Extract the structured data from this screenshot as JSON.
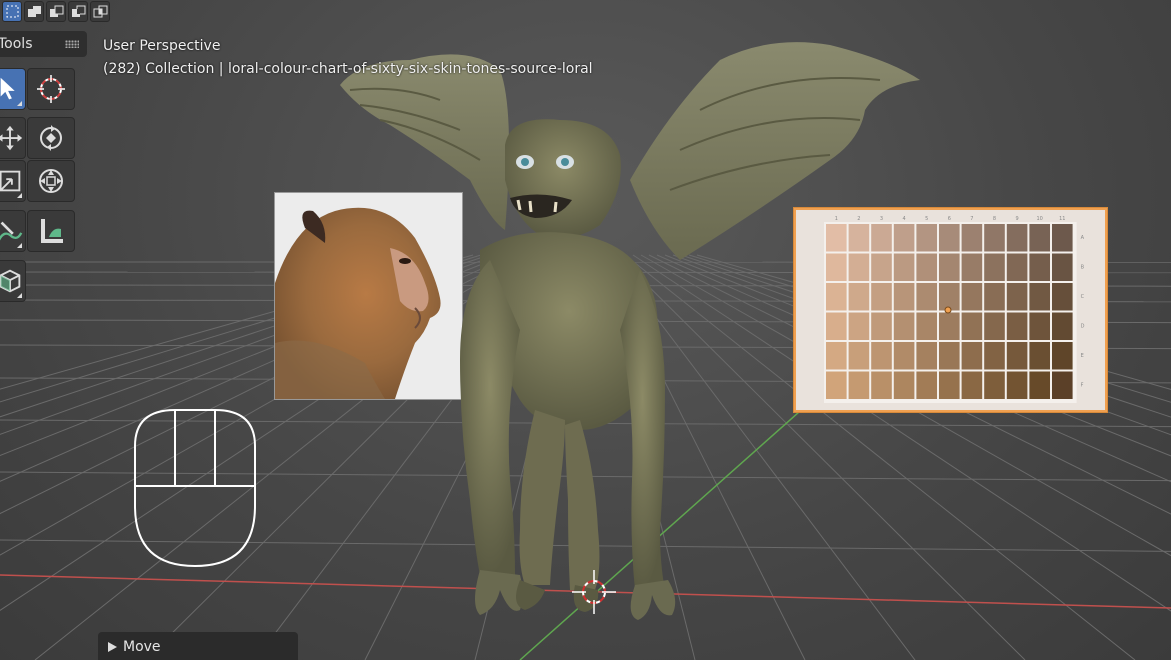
{
  "header": {
    "mode_buttons": [
      {
        "name": "select-box-mode-icon",
        "active": true
      },
      {
        "name": "mode-extend-icon",
        "active": false
      },
      {
        "name": "mode-subtract-icon",
        "active": false
      },
      {
        "name": "mode-difference-icon",
        "active": false
      },
      {
        "name": "mode-intersect-icon",
        "active": false
      }
    ]
  },
  "toolbar": {
    "title": "Tools",
    "tools": [
      {
        "name": "select-tool-icon",
        "active": true
      },
      {
        "name": "cursor-tool-icon",
        "active": false
      },
      {
        "name": "move-tool-icon",
        "active": false
      },
      {
        "name": "rotate-tool-icon",
        "active": false
      },
      {
        "name": "scale-tool-icon",
        "active": false
      },
      {
        "name": "transform-tool-icon",
        "active": false
      },
      {
        "name": "annotate-tool-icon",
        "active": false
      },
      {
        "name": "measure-tool-icon",
        "active": false
      },
      {
        "name": "add-cube-tool-icon",
        "active": false
      }
    ]
  },
  "viewport": {
    "view_name": "User Perspective",
    "collection_info": "(282) Collection | loral-colour-chart-of-sixty-six-skin-tones-source-loral",
    "chart_column_numbers": [
      "1",
      "2",
      "3",
      "4",
      "5",
      "6",
      "7",
      "8",
      "9",
      "10",
      "11"
    ],
    "chart_row_letters": [
      "A",
      "B",
      "C",
      "D",
      "E",
      "F"
    ]
  },
  "operator_panel": {
    "label": "Move"
  },
  "colors": {
    "accent": "#4772b3",
    "selection_outline": "#f0a050",
    "x_axis": "#c0504d",
    "y_axis": "#5fa64f"
  }
}
